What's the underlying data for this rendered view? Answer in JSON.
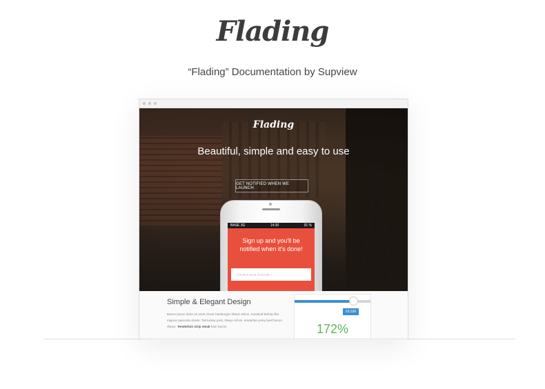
{
  "page": {
    "logo_text": "Flading",
    "doc_title": "“Flading” Documentation by Supview"
  },
  "browser": {
    "hero": {
      "logo_text": "Flading",
      "headline": "Beautiful, simple and easy to use",
      "notify_button": "GET NOTIFIED WHEN WE LAUNCH"
    },
    "phone": {
      "carrier": "BASE",
      "network": "3G",
      "time": "14:30",
      "battery": "91 %",
      "signup_text": "Sign up and you'll be notified when it's done!",
      "email_placeholder": "YOUR E-MAIL PLEASE ?"
    },
    "content": {
      "section_title": "Simple & Elegant Design",
      "body_text_1": "Bacon ipsum dolor sit amet chuck hamburger ribeye sirloin, meatloaf ball tip filet mignon pancetta shank. Tail turkey pork, ribeye sirloin, tenderloin jerky beef bacon ribeye.",
      "body_bold": "Tenderloin strip steak",
      "body_text_2": "ham bacon",
      "widget": {
        "price": "£6,530",
        "percent": "172%",
        "slider_level": 0.76,
        "accent_color": "#3a8fd1",
        "percent_color": "#5cb85c"
      }
    }
  },
  "colors": {
    "cta_red": "#e8503d",
    "text_dark": "#444444"
  }
}
